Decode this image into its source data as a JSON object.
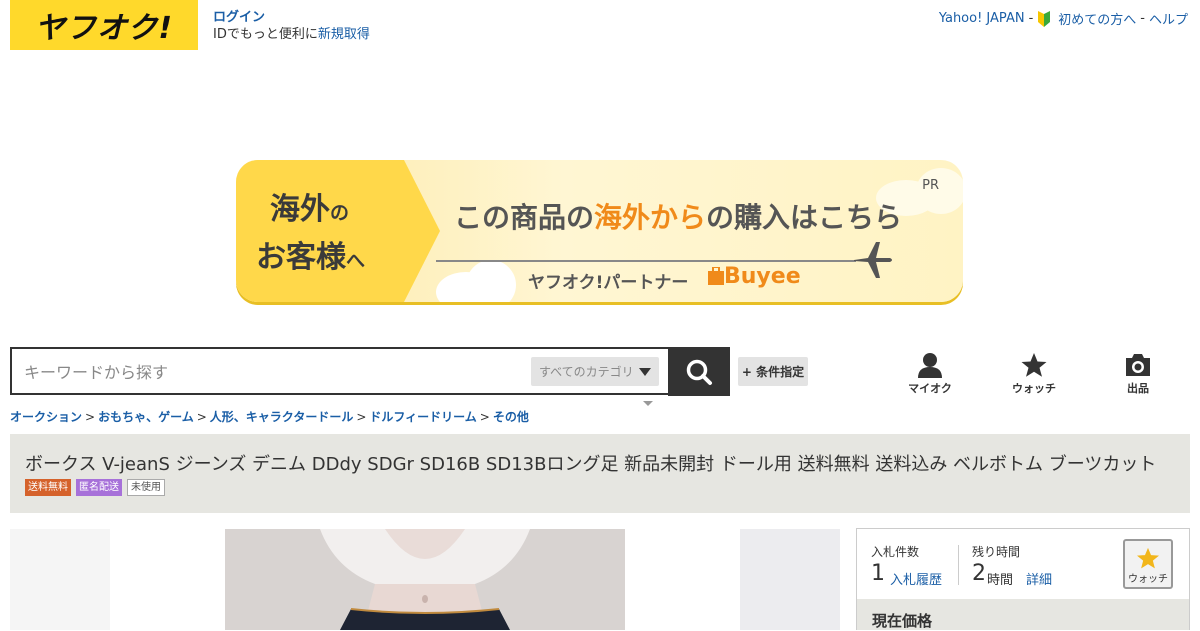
{
  "header": {
    "logo_text": "ヤフオク!",
    "login_label": "ログイン",
    "login_sub_text": "IDでもっと便利に",
    "register_link": "新規取得",
    "yahoo_japan_link": "Yahoo! JAPAN",
    "separator": "-",
    "beginner_link": "初めての方へ",
    "help_link": "ヘルプ"
  },
  "banner": {
    "left_line1_big": "海外",
    "left_line1_small": "の",
    "left_line2_big": "お客様",
    "left_line2_small": "へ",
    "main_part1": "この商品の",
    "main_highlight": "海外から",
    "main_part2": "の購入はこちら",
    "pr_label": "PR",
    "partner_text": "ヤフオク!パートナー",
    "buyee_text": "Buyee",
    "colors": {
      "accent": "#f08a1a",
      "yellow": "#ffd84a"
    }
  },
  "search": {
    "placeholder": "キーワードから探す",
    "category_label": "すべてのカテゴリ",
    "advanced_label": "+ 条件指定"
  },
  "nav": {
    "myauction_label": "マイオク",
    "watch_label": "ウォッチ",
    "sell_label": "出品"
  },
  "breadcrumb": {
    "items": [
      "オークション",
      "おもちゃ、ゲーム",
      "人形、キャラクタードール",
      "ドルフィードリーム",
      "その他"
    ],
    "separator": ">"
  },
  "item": {
    "title": "ボークス V-jeanS ジーンズ デニム DDdy SDGr SD16B SD13Bロング足 新品未開封 ドール用 送料無料 送料込み ベルボトム ブーツカット",
    "badges": {
      "shipping": "送料無料",
      "anonymous": "匿名配送",
      "unused": "未使用"
    }
  },
  "bid_panel": {
    "bid_count_label": "入札件数",
    "bid_count_value": "1",
    "bid_history_link": "入札履歴",
    "time_left_label": "残り時間",
    "time_left_value": "2",
    "time_left_unit": "時間",
    "detail_link": "詳細",
    "watch_label": "ウォッチ",
    "current_price_label": "現在価格"
  }
}
